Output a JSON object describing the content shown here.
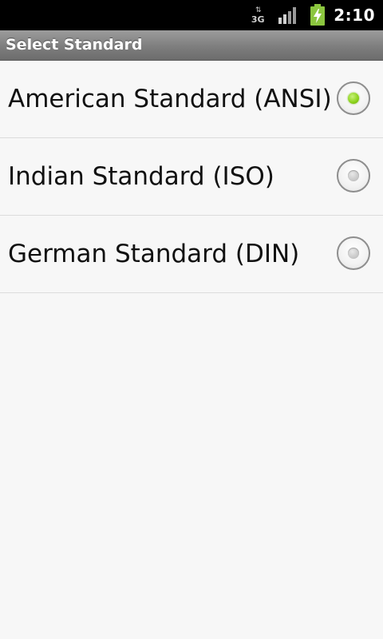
{
  "status_bar": {
    "network_label": "3G",
    "time": "2:10",
    "icons": [
      "data-arrows-icon",
      "signal-icon",
      "battery-charging-icon"
    ]
  },
  "title_bar": {
    "title": "Select Standard"
  },
  "options": [
    {
      "label": "American Standard (ANSI)",
      "selected": true
    },
    {
      "label": "Indian Standard (ISO)",
      "selected": false
    },
    {
      "label": "German Standard (DIN)",
      "selected": false
    }
  ],
  "colors": {
    "selected_radio": "#8ad11a",
    "battery": "#8cc63f",
    "background": "#f7f7f7"
  }
}
